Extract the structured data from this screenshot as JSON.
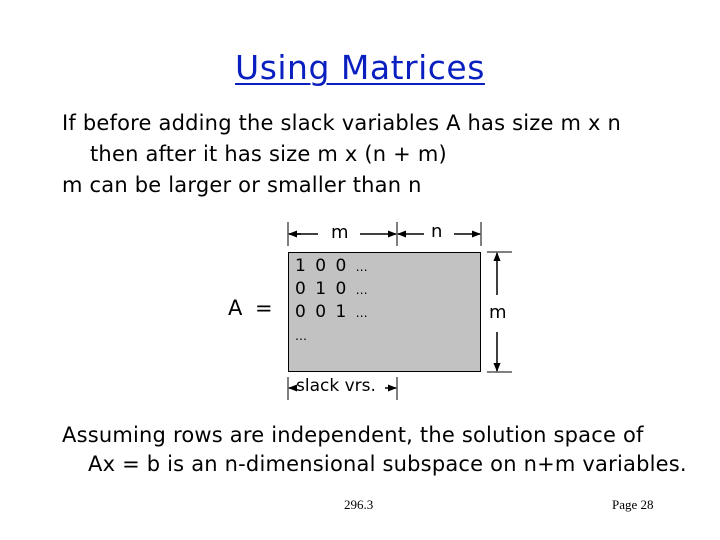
{
  "slide": {
    "title": "Using Matrices",
    "body_lines": [
      "If before adding the slack variables A has size m x n",
      "then after it has size m x (n + m)",
      "m can be larger or smaller than n"
    ],
    "diagram": {
      "matrix_label": "A =",
      "matrix_rows": [
        {
          "values": "1 0 0",
          "ellipsis": "…"
        },
        {
          "values": "0 1 0",
          "ellipsis": "…"
        },
        {
          "values": "0 0 1",
          "ellipsis": "…"
        },
        {
          "values": "",
          "ellipsis": "…"
        }
      ],
      "top_dimension_left": "m",
      "top_dimension_right": "n",
      "right_dimension": "m",
      "bottom_label": "slack vrs.",
      "matrix_fill": "#c2c2c2"
    },
    "conclusion_lines": [
      "Assuming rows are independent, the solution space of",
      "Ax = b is an n-dimensional subspace on n+m variables."
    ],
    "footer": {
      "course": "296.3",
      "page": "Page 28"
    },
    "title_color": "#0a1fbf"
  }
}
